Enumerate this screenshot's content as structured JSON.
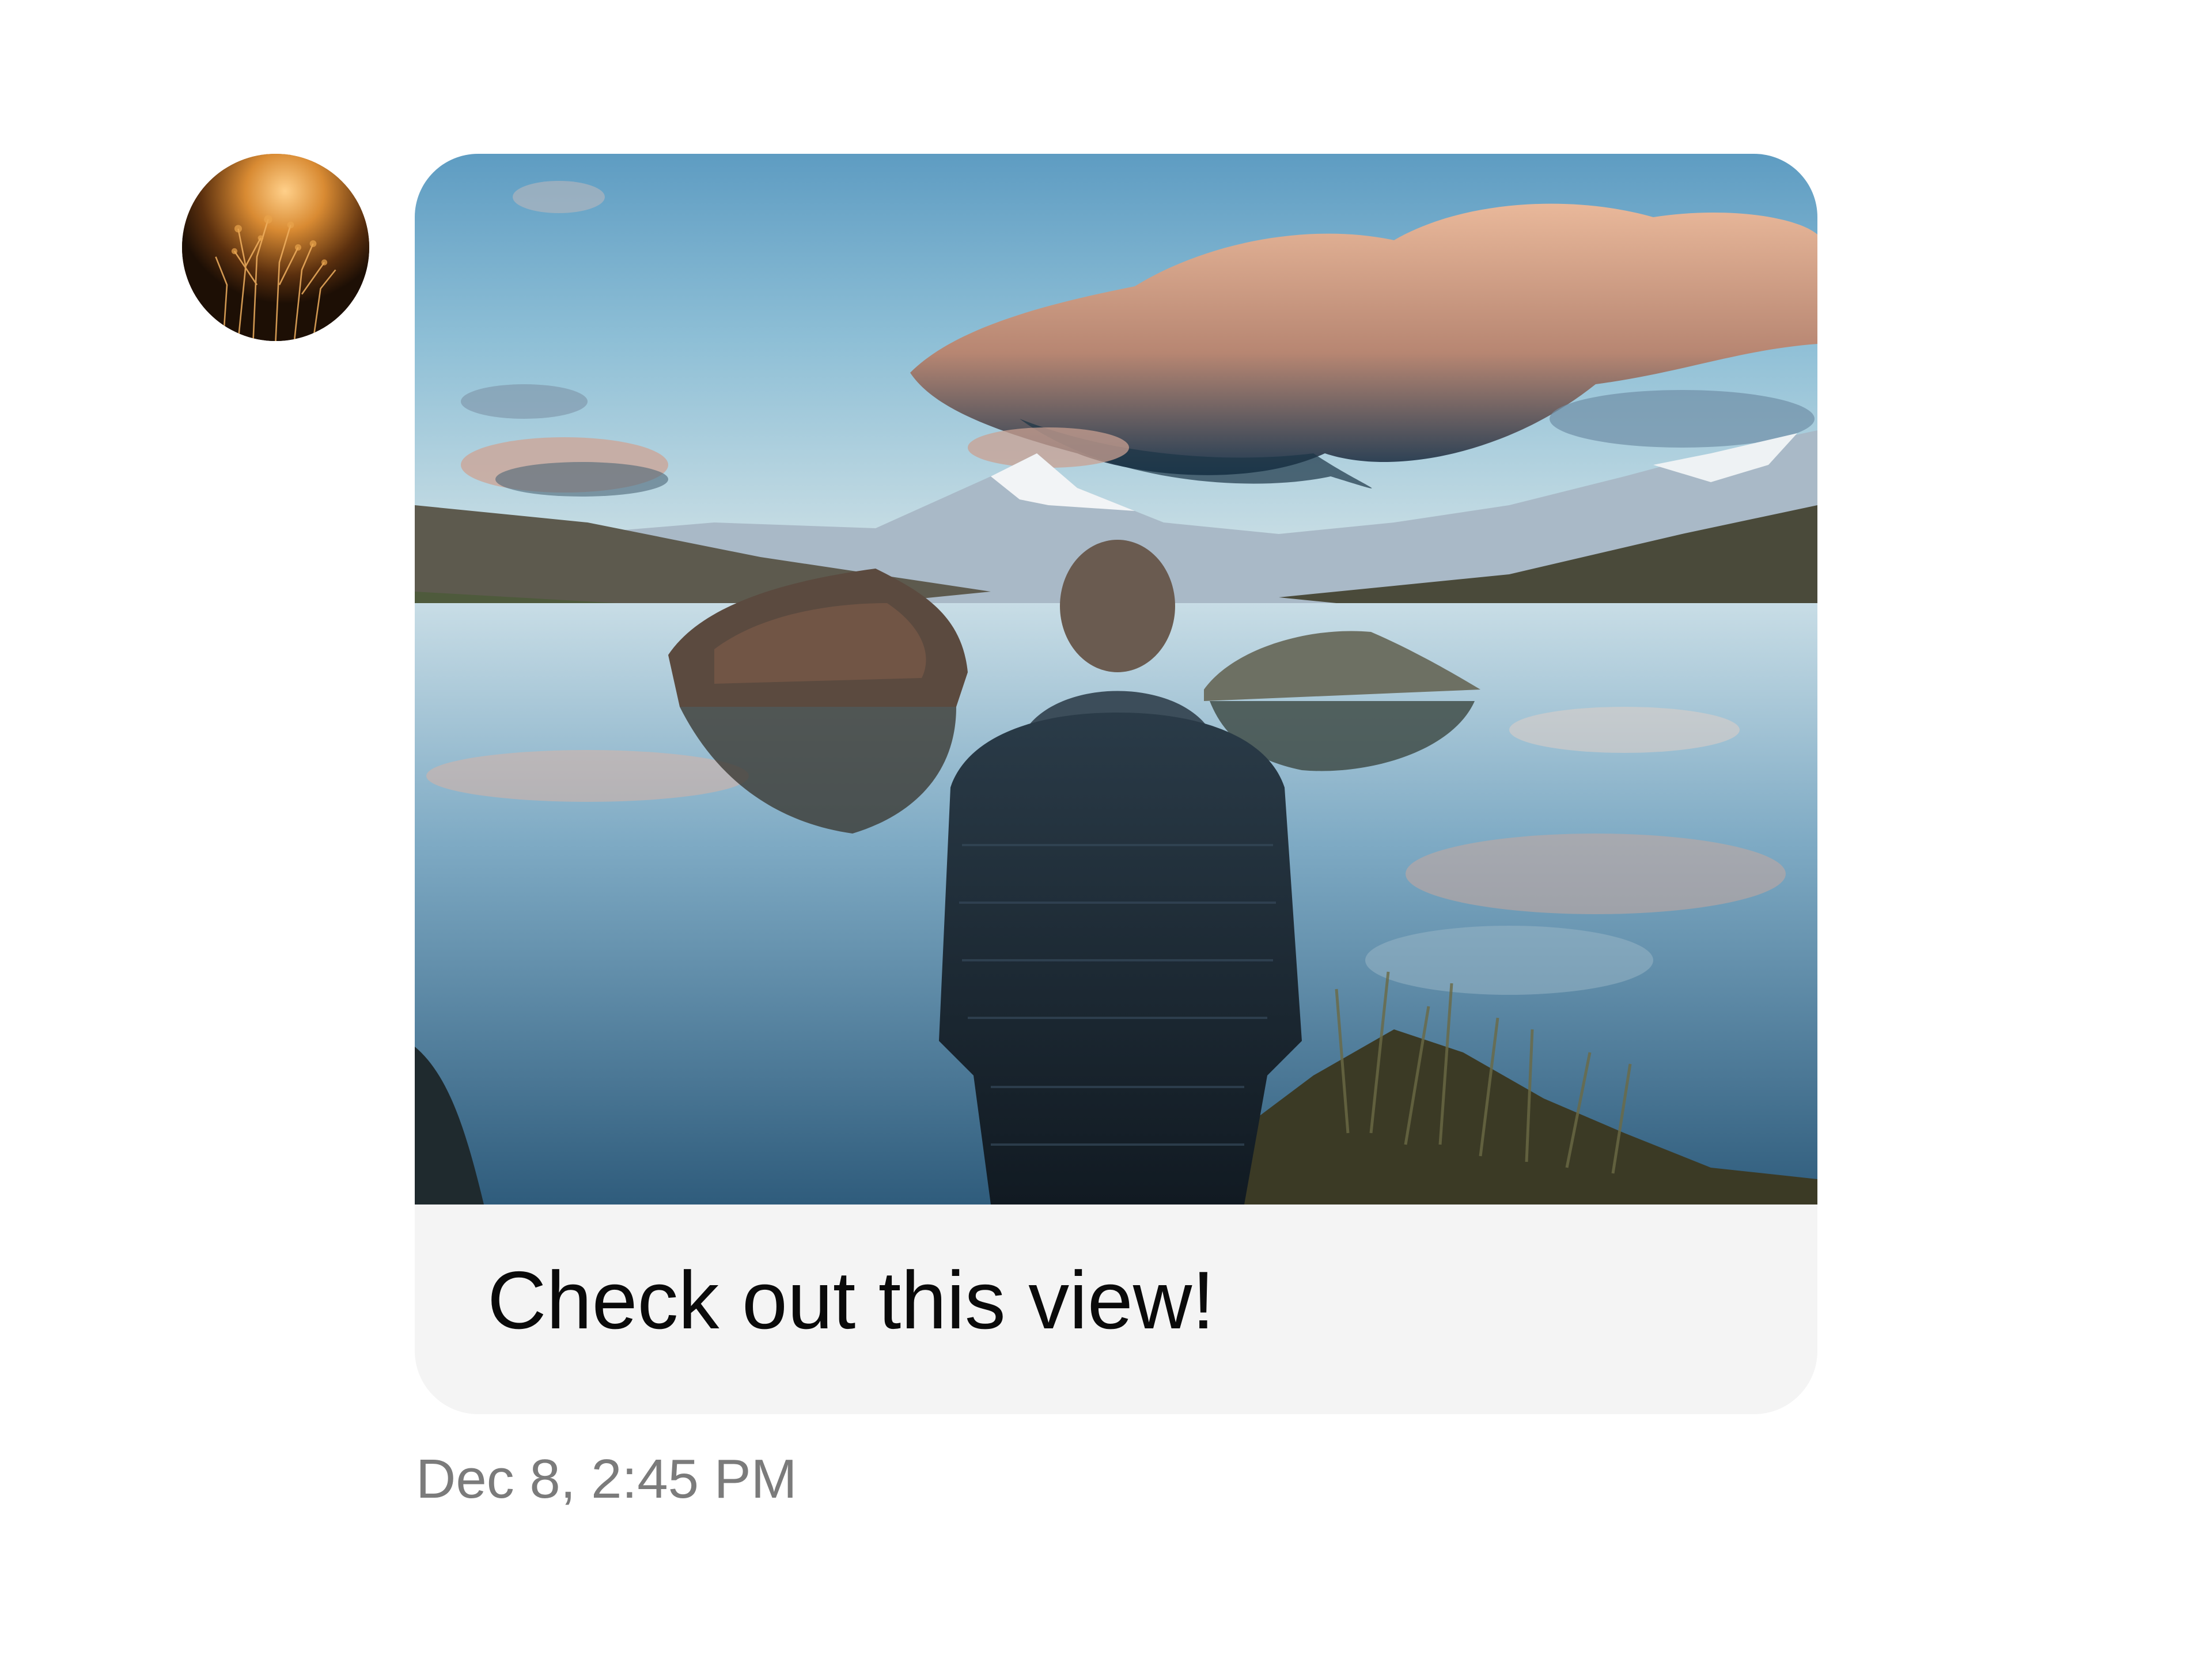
{
  "message": {
    "caption": "Check out this view!",
    "timestamp": "Dec 8, 2:45 PM",
    "sender_avatar_icon": "avatar-image",
    "attachment_icon": "photo-attachment"
  },
  "colors": {
    "bubble_background": "#f4f4f4",
    "caption_text": "#0a0a0a",
    "timestamp_text": "#7b7b7b",
    "page_background": "#ffffff"
  }
}
